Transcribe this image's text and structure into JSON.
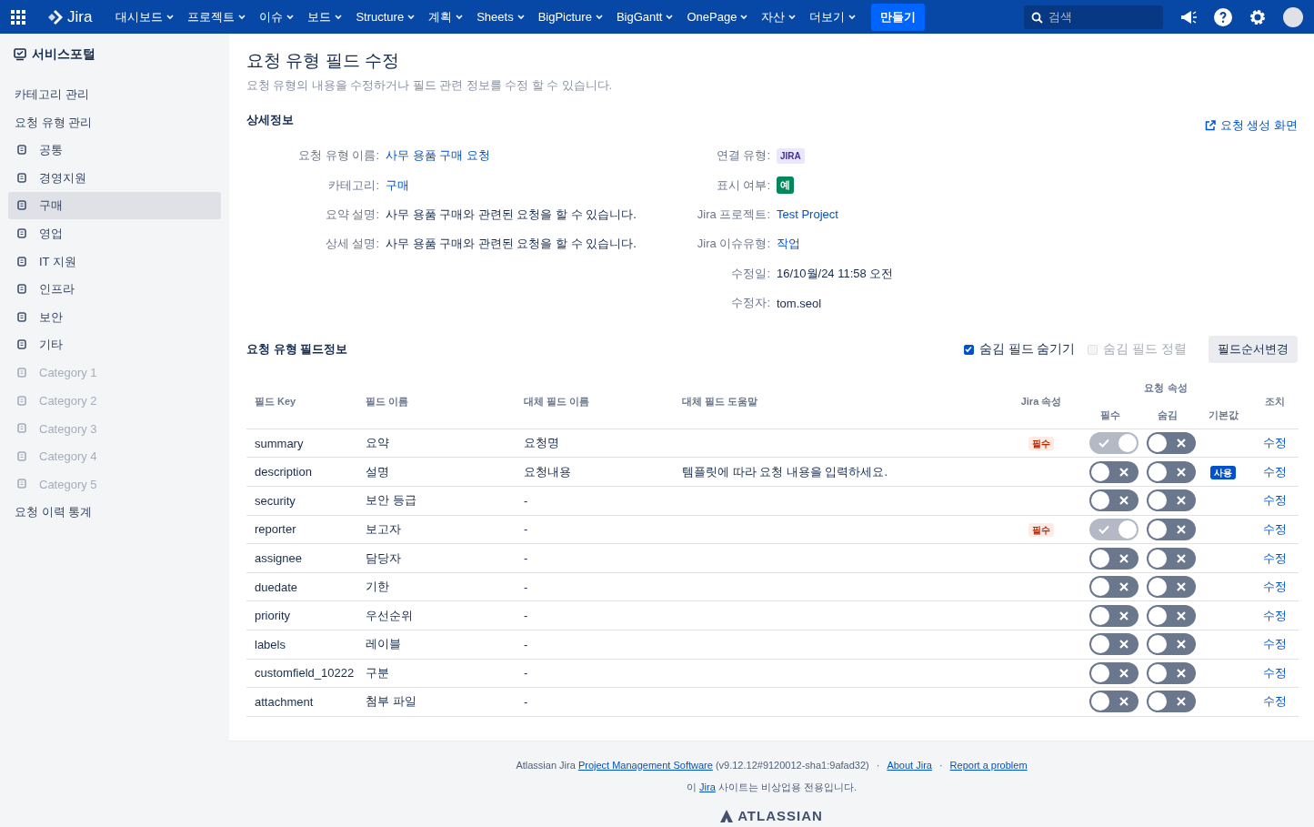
{
  "topbar": {
    "product": "Jira",
    "nav": [
      {
        "label": "대시보드"
      },
      {
        "label": "프로젝트"
      },
      {
        "label": "이슈"
      },
      {
        "label": "보드"
      },
      {
        "label": "Structure"
      },
      {
        "label": "계획"
      },
      {
        "label": "Sheets"
      },
      {
        "label": "BigPicture"
      },
      {
        "label": "BigGantt"
      },
      {
        "label": "OnePage"
      },
      {
        "label": "자산"
      },
      {
        "label": "더보기"
      }
    ],
    "create": "만들기",
    "search": {
      "placeholder": "검색"
    }
  },
  "sidebar": {
    "title": "서비스포털",
    "items": [
      {
        "label": "카테고리 관리",
        "kind": "link",
        "selected": false,
        "disabled": false
      },
      {
        "label": "요청 유형 관리",
        "kind": "link",
        "selected": false,
        "disabled": false
      },
      {
        "label": "공통",
        "kind": "type",
        "selected": false,
        "disabled": false
      },
      {
        "label": "경영지원",
        "kind": "type",
        "selected": false,
        "disabled": false
      },
      {
        "label": "구매",
        "kind": "type",
        "selected": true,
        "disabled": false
      },
      {
        "label": "영업",
        "kind": "type",
        "selected": false,
        "disabled": false
      },
      {
        "label": "IT 지원",
        "kind": "type",
        "selected": false,
        "disabled": false
      },
      {
        "label": "인프라",
        "kind": "type",
        "selected": false,
        "disabled": false
      },
      {
        "label": "보안",
        "kind": "type",
        "selected": false,
        "disabled": false
      },
      {
        "label": "기타",
        "kind": "type",
        "selected": false,
        "disabled": false
      },
      {
        "label": "Category 1",
        "kind": "type",
        "selected": false,
        "disabled": true
      },
      {
        "label": "Category 2",
        "kind": "type",
        "selected": false,
        "disabled": true
      },
      {
        "label": "Category 3",
        "kind": "type",
        "selected": false,
        "disabled": true
      },
      {
        "label": "Category 4",
        "kind": "type",
        "selected": false,
        "disabled": true
      },
      {
        "label": "Category 5",
        "kind": "type",
        "selected": false,
        "disabled": true
      },
      {
        "label": "요청 이력 통계",
        "kind": "link",
        "selected": false,
        "disabled": false
      }
    ]
  },
  "page": {
    "title": "요청 유형 필드 수정",
    "subtitle": "요청 유형의 내용을 수정하거나 필드 관련 정보를 수정 할 수 있습니다.",
    "details_heading": "상세정보",
    "create_screen_link": "요청 생성 화면",
    "details_left": [
      {
        "label": "요청 유형 이름:",
        "value": "사무 용품 구매 요청",
        "kind": "link"
      },
      {
        "label": "카테고리:",
        "value": "구매",
        "kind": "link"
      },
      {
        "label": "요약 설명:",
        "value": "사무 용품 구매와 관련된 요청을 할 수 있습니다.",
        "kind": "text"
      },
      {
        "label": "상세 설명:",
        "value": "사무 용품 구매와 관련된 요청을 할 수 있습니다.",
        "kind": "text"
      }
    ],
    "details_right": [
      {
        "label": "연결 유형:",
        "value": "JIRA",
        "kind": "lozenge"
      },
      {
        "label": "표시 여부:",
        "value": "예",
        "kind": "yes"
      },
      {
        "label": "Jira 프로젝트:",
        "value": "Test Project",
        "kind": "link"
      },
      {
        "label": "Jira 이슈유형:",
        "value": "작업",
        "kind": "link"
      },
      {
        "label": "수정일:",
        "value": "16/10월/24 11:58 오전",
        "kind": "text"
      },
      {
        "label": "수정자:",
        "value": "tom.seol",
        "kind": "text"
      }
    ]
  },
  "fields": {
    "heading": "요청 유형 필드정보",
    "hide_hidden": {
      "label": "숨김 필드 숨기기",
      "checked": true,
      "disabled": false
    },
    "sort_hidden": {
      "label": "숨김 필드 정렬",
      "checked": false,
      "disabled": true
    },
    "reorder_button": "필드순서변경",
    "columns": {
      "key": "필드 Key",
      "name": "필드 이름",
      "alt_name": "대체 필드 이름",
      "alt_help": "대체 필드 도움말",
      "jira": "Jira 속성",
      "group": "요청 속성",
      "required": "필수",
      "hidden": "숨김",
      "default": "기본값",
      "action": "조치"
    },
    "rows": [
      {
        "key": "summary",
        "name": "요약",
        "alt_name": "요청명",
        "jira": "필수",
        "required": {
          "on": true,
          "disabled": true
        },
        "hidden": {
          "on": false
        },
        "action": "수정"
      },
      {
        "key": "description",
        "name": "설명",
        "alt_name": "요청내용",
        "alt_help": "템플릿에 따라 요청 내용을 입력하세요.",
        "required": {
          "on": false,
          "disabled": false
        },
        "hidden": {
          "on": false
        },
        "default": "사용",
        "action": "수정"
      },
      {
        "key": "security",
        "name": "보안 등급",
        "alt_name": "-",
        "required": {
          "on": false,
          "disabled": false
        },
        "hidden": {
          "on": false
        },
        "action": "수정"
      },
      {
        "key": "reporter",
        "name": "보고자",
        "alt_name": "-",
        "jira": "필수",
        "required": {
          "on": true,
          "disabled": true
        },
        "hidden": {
          "on": false
        },
        "action": "수정"
      },
      {
        "key": "assignee",
        "name": "담당자",
        "alt_name": "-",
        "required": {
          "on": false,
          "disabled": false
        },
        "hidden": {
          "on": false
        },
        "action": "수정"
      },
      {
        "key": "duedate",
        "name": "기한",
        "alt_name": "-",
        "required": {
          "on": false,
          "disabled": false
        },
        "hidden": {
          "on": false
        },
        "action": "수정"
      },
      {
        "key": "priority",
        "name": "우선순위",
        "alt_name": "-",
        "required": {
          "on": false,
          "disabled": false
        },
        "hidden": {
          "on": false
        },
        "action": "수정"
      },
      {
        "key": "labels",
        "name": "레이블",
        "alt_name": "-",
        "required": {
          "on": false,
          "disabled": false
        },
        "hidden": {
          "on": false
        },
        "action": "수정"
      },
      {
        "key": "customfield_10222",
        "name": "구분",
        "alt_name": "-",
        "required": {
          "on": false,
          "disabled": false
        },
        "hidden": {
          "on": false
        },
        "action": "수정"
      },
      {
        "key": "attachment",
        "name": "첨부 파일",
        "alt_name": "-",
        "required": {
          "on": false,
          "disabled": false
        },
        "hidden": {
          "on": false
        },
        "action": "수정"
      }
    ]
  },
  "footer": {
    "separator_1": "·",
    "separator_2": "·",
    "prefix": "Atlassian Jira",
    "software_link": "Project Management Software",
    "version": "(v9.12.12#9120012-sha1:9afad32)",
    "about": "About Jira",
    "report": "Report a problem",
    "notice_before": "이",
    "notice_link": "Jira",
    "notice_after": "사이트는 비상업용 전용입니다.",
    "logo": "ATLASSIAN"
  }
}
